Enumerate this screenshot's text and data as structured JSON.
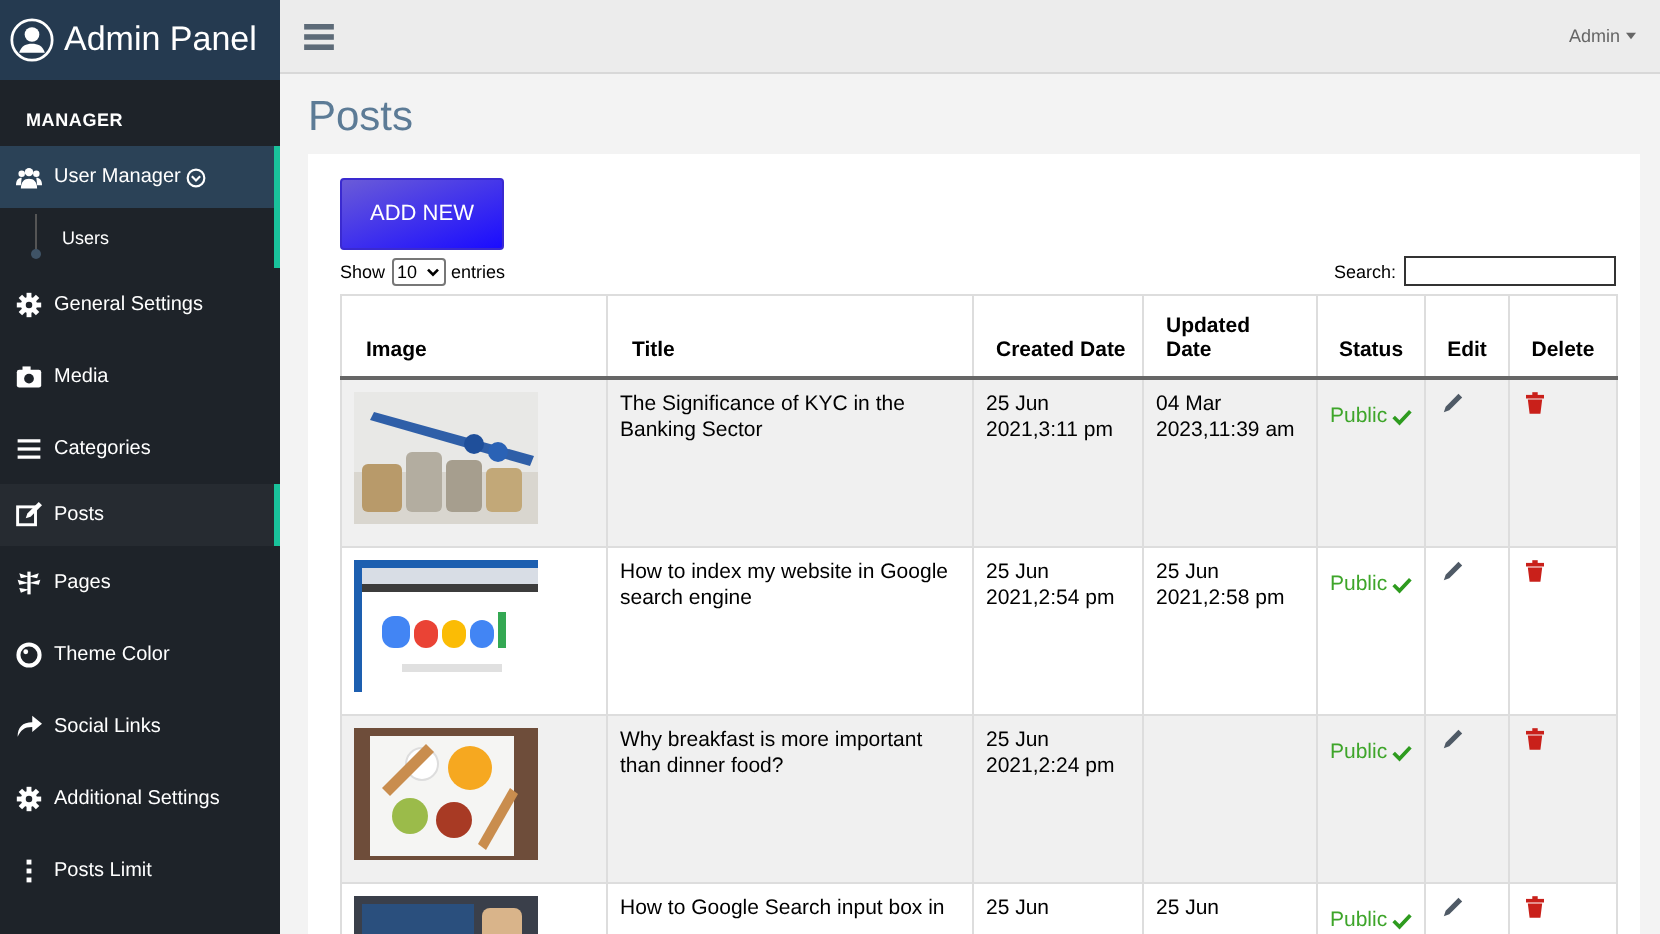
{
  "sidebar": {
    "brand": "Admin Panel",
    "section": "MANAGER",
    "items": [
      {
        "label": "User Manager",
        "selected": false,
        "expanded": true,
        "children": [
          {
            "label": "Users",
            "selected": false
          }
        ]
      },
      {
        "label": "General Settings",
        "selected": false
      },
      {
        "label": "Media",
        "selected": false
      },
      {
        "label": "Categories",
        "selected": false
      },
      {
        "label": "Posts",
        "selected": true
      },
      {
        "label": "Pages",
        "selected": false
      },
      {
        "label": "Theme Color",
        "selected": false
      },
      {
        "label": "Social Links",
        "selected": false
      },
      {
        "label": "Additional Settings",
        "selected": false
      },
      {
        "label": "Posts Limit",
        "selected": false
      }
    ]
  },
  "topbar": {
    "user": "Admin"
  },
  "page_title": "Posts",
  "add_button": "ADD NEW",
  "entries": {
    "prefix": "Show",
    "value": "10",
    "suffix": "entries"
  },
  "search": {
    "label": "Search:"
  },
  "table": {
    "columns": [
      "Image",
      "Title",
      "Created Date",
      "Updated Date",
      "Status",
      "Edit",
      "Delete"
    ],
    "rows": [
      {
        "image": {
          "kind": "picture"
        },
        "title": "The Significance of KYC in the Banking Sector",
        "created": [
          "25 Jun",
          "2021,3:11 pm"
        ],
        "updated": [
          "04 Mar",
          "2023,11:39 am"
        ],
        "status": "Public",
        "public": true
      },
      {
        "image": {
          "kind": "picture"
        },
        "title": "How to index my website in Google search engine",
        "created": [
          "25 Jun",
          "2021,2:54 pm"
        ],
        "updated": [
          "25 Jun",
          "2021,2:58 pm"
        ],
        "status": "Public",
        "public": true
      },
      {
        "image": {
          "kind": "picture"
        },
        "title": "Why breakfast is more important than dinner food?",
        "created": [
          "25 Jun",
          "2021,2:24 pm"
        ],
        "updated": [],
        "status": "Public",
        "public": true
      },
      {
        "image": {
          "kind": "picture"
        },
        "title": "How to Google Search input box in",
        "created": [
          "25 Jun"
        ],
        "updated": [
          "25 Jun"
        ],
        "status": "Public",
        "public": true
      }
    ]
  }
}
